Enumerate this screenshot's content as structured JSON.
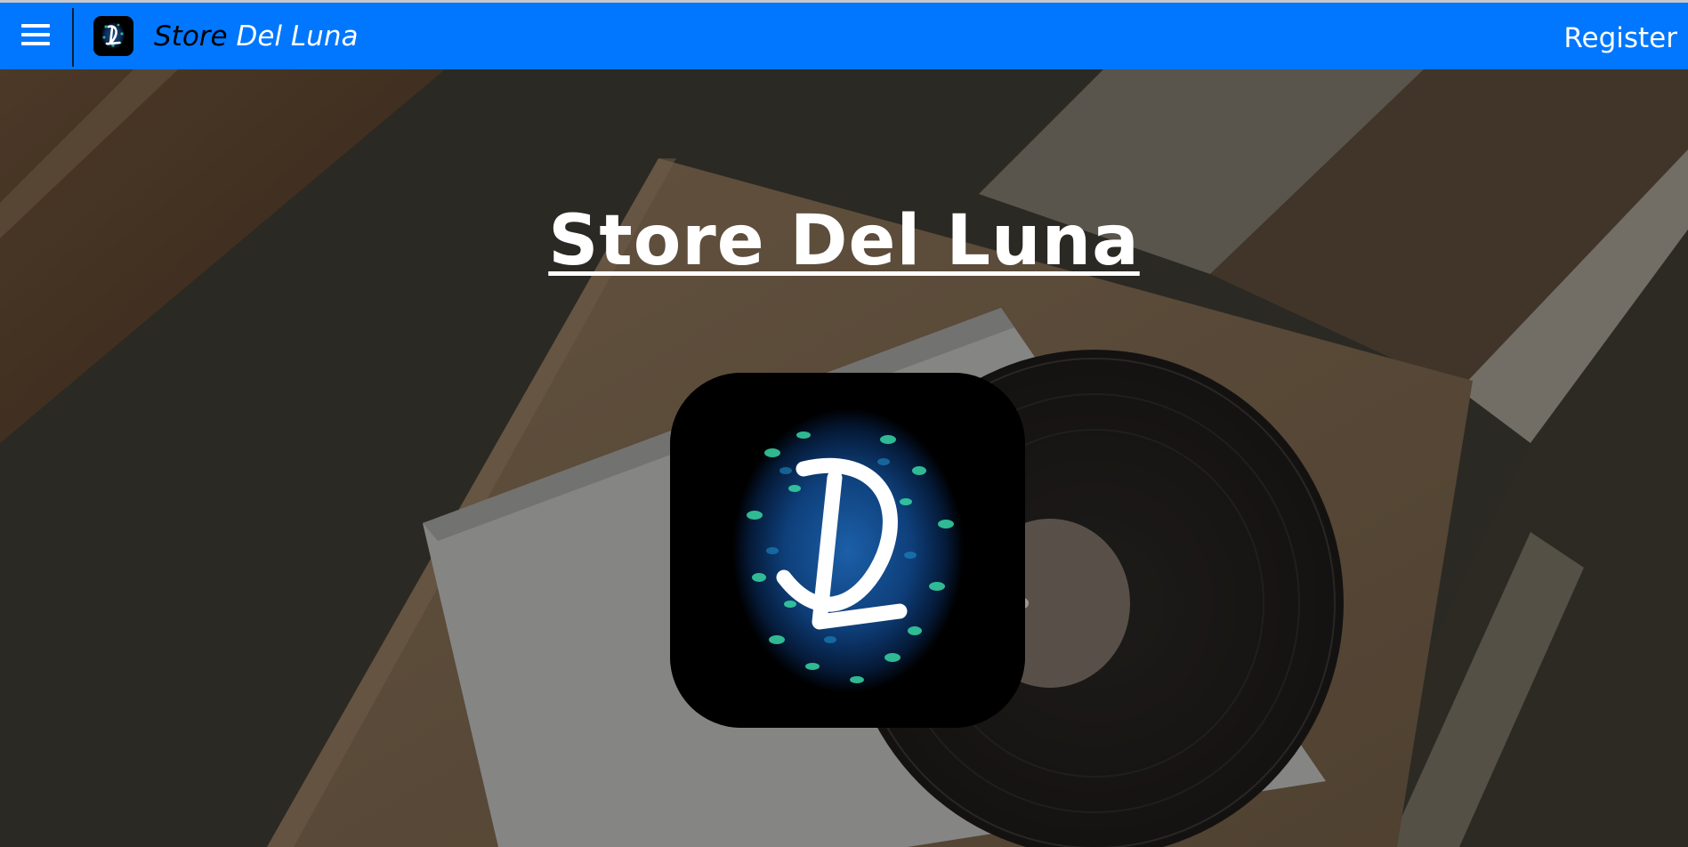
{
  "nav": {
    "menu_icon": "hamburger-menu-icon",
    "logo_icon": "store-del-luna-logo",
    "brand_part1": "Store ",
    "brand_part2": "Del Luna",
    "register_label": "Register"
  },
  "hero": {
    "title": "Store Del Luna",
    "logo_icon": "store-del-luna-logo",
    "background": "record-player-photo"
  },
  "colors": {
    "navbar": "#0077fe",
    "brand_dark": "#000000",
    "text_light": "#ffffff"
  }
}
